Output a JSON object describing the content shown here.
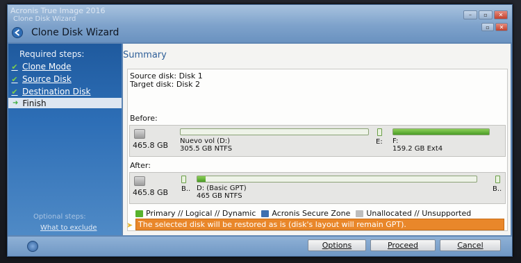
{
  "window": {
    "app_title": "Acronis True Image 2016",
    "sub_title": "Clone Disk Wizard",
    "wizard_title": "Clone Disk Wizard"
  },
  "sidebar": {
    "required_heading": "Required steps:",
    "steps": [
      {
        "label": "Clone Mode",
        "done": true
      },
      {
        "label": "Source Disk",
        "done": true
      },
      {
        "label": "Destination Disk",
        "done": true
      },
      {
        "label": "Finish",
        "done": false
      }
    ],
    "optional_heading": "Optional steps:",
    "optional_link": "What to exclude"
  },
  "content": {
    "title": "Summary",
    "source": "Source disk: Disk 1",
    "target": "Target disk: Disk 2",
    "before_label": "Before:",
    "after_label": "After:",
    "before": {
      "size": "465.8 GB",
      "p1_name": "Nuevo vol (D:)",
      "p1_detail": "305.5 GB  NTFS",
      "p2_letter": "E:",
      "p3_name": "F:",
      "p3_detail": "159.2 GB  Ext4",
      "p3_fill": 1.0
    },
    "after": {
      "size": "465.8 GB",
      "p1_name": "B..",
      "p2_name": "D: (Basic GPT)",
      "p2_detail": "465 GB  NTFS",
      "p2_fill": 0.03,
      "p3_name": "B.."
    },
    "legend": {
      "primary": "Primary // Logical // Dynamic",
      "secure": "Acronis Secure Zone",
      "unallocated": "Unallocated // Unsupported"
    },
    "warning": "The selected disk will be restored as is (disk's layout will remain GPT)."
  },
  "buttons": {
    "options": "Options",
    "proceed": "Proceed",
    "cancel": "Cancel"
  },
  "colors": {
    "accent_blue": "#2e5f98",
    "warning_orange": "#e9872a",
    "partition_green": "#57b22c"
  }
}
